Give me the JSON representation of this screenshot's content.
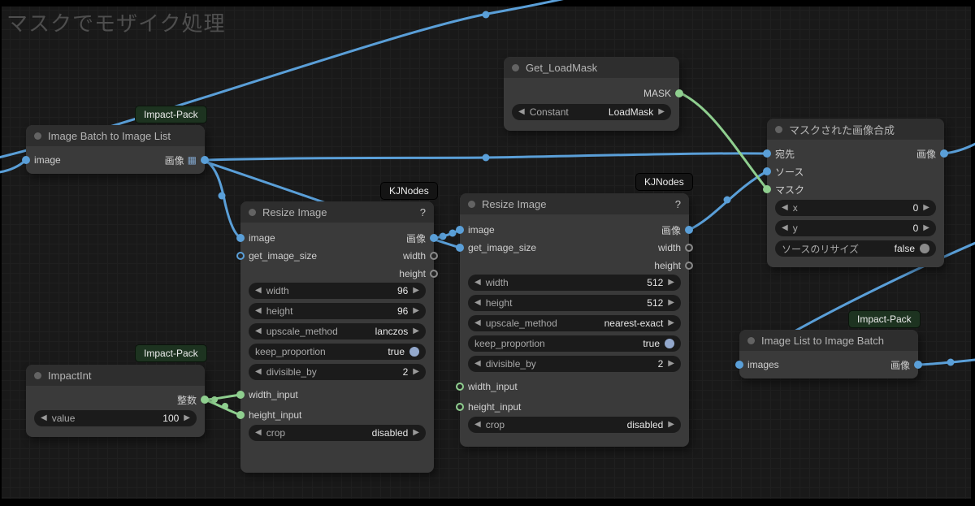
{
  "canvas_title": "マスクでモザイク処理",
  "colors": {
    "wire_image": "#5a9fd8",
    "wire_mask": "#90cf90",
    "toggle_true": "#93a8cc",
    "toggle_false": "#8a8a8a",
    "node_bg": "#3a3a3a",
    "node_header": "#2e2e2e",
    "widget_bg": "#1b1b1b"
  },
  "icons": {
    "arrow_left": "◀",
    "arrow_right": "▶",
    "help": "?",
    "list_grid": "▦"
  },
  "nodes": {
    "batch_to_list": {
      "title": "Image Batch to Image List",
      "badge": "Impact-Pack",
      "input_image": "image",
      "output_image": "画像"
    },
    "get_loadmask": {
      "title": "Get_LoadMask",
      "output_mask": "MASK",
      "widget_constant": {
        "label": "Constant",
        "value": "LoadMask"
      }
    },
    "resize_small": {
      "title": "Resize Image",
      "badge": "KJNodes",
      "inputs": {
        "image": "image",
        "get_image_size": "get_image_size",
        "width_input": "width_input",
        "height_input": "height_input"
      },
      "outputs": {
        "image": "画像",
        "width": "width",
        "height": "height"
      },
      "widgets": [
        {
          "label": "width",
          "value": "96"
        },
        {
          "label": "height",
          "value": "96"
        },
        {
          "label": "upscale_method",
          "value": "lanczos"
        },
        {
          "label": "keep_proportion",
          "value": "true"
        },
        {
          "label": "divisible_by",
          "value": "2"
        },
        {
          "label": "crop",
          "value": "disabled"
        }
      ]
    },
    "resize_large": {
      "title": "Resize Image",
      "badge": "KJNodes",
      "inputs": {
        "image": "image",
        "get_image_size": "get_image_size",
        "width_input": "width_input",
        "height_input": "height_input"
      },
      "outputs": {
        "image": "画像",
        "width": "width",
        "height": "height"
      },
      "widgets": [
        {
          "label": "width",
          "value": "512"
        },
        {
          "label": "height",
          "value": "512"
        },
        {
          "label": "upscale_method",
          "value": "nearest-exact"
        },
        {
          "label": "keep_proportion",
          "value": "true"
        },
        {
          "label": "divisible_by",
          "value": "2"
        },
        {
          "label": "crop",
          "value": "disabled"
        }
      ]
    },
    "impact_int": {
      "title": "ImpactInt",
      "badge": "Impact-Pack",
      "output_int": "整数",
      "widget_value": {
        "label": "value",
        "value": "100"
      }
    },
    "composite": {
      "title": "マスクされた画像合成",
      "inputs": {
        "destination": "宛先",
        "source": "ソース",
        "mask": "マスク"
      },
      "output_image": "画像",
      "widgets": [
        {
          "label": "x",
          "value": "0"
        },
        {
          "label": "y",
          "value": "0"
        },
        {
          "label": "ソースのリサイズ",
          "value": "false"
        }
      ]
    },
    "list_to_batch": {
      "title": "Image List to Image Batch",
      "badge": "Impact-Pack",
      "input_images": "images",
      "output_image": "画像"
    }
  }
}
